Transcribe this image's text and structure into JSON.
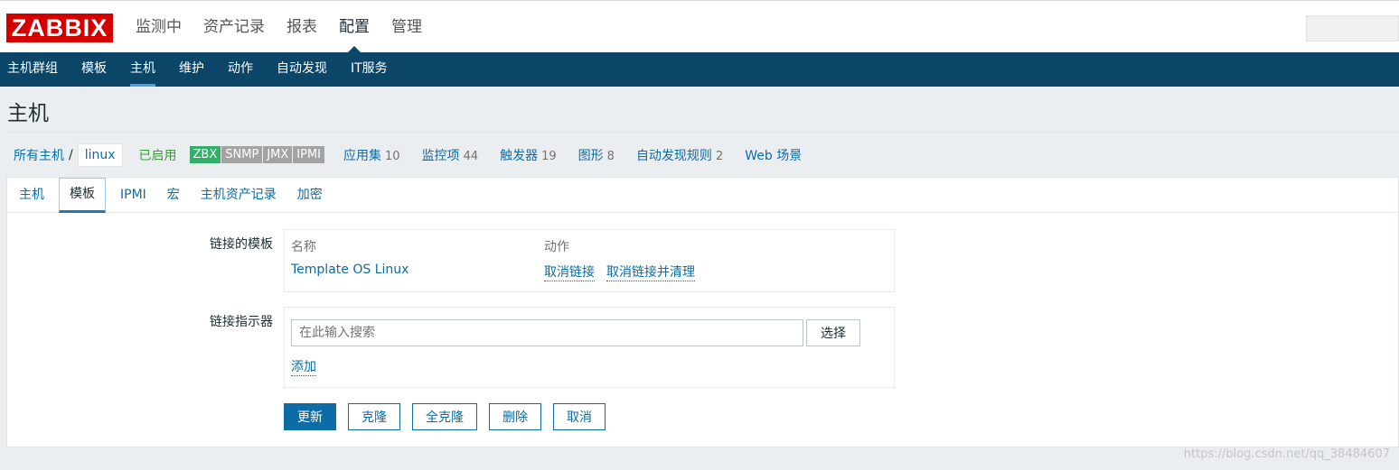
{
  "header": {
    "logo": "ZABBIX",
    "main_nav": [
      "监测中",
      "资产记录",
      "报表",
      "配置",
      "管理"
    ],
    "main_nav_active": 3,
    "sub_nav": [
      "主机群组",
      "模板",
      "主机",
      "维护",
      "动作",
      "自动发现",
      "IT服务"
    ],
    "sub_nav_active": 2
  },
  "page": {
    "title": "主机"
  },
  "breadcrumb": {
    "all_hosts": "所有主机",
    "separator": "/",
    "host": "linux",
    "status": "已启用",
    "badges": [
      {
        "label": "ZBX",
        "on": true
      },
      {
        "label": "SNMP",
        "on": false
      },
      {
        "label": "JMX",
        "on": false
      },
      {
        "label": "IPMI",
        "on": false
      }
    ],
    "links": [
      {
        "label": "应用集",
        "count": "10"
      },
      {
        "label": "监控项",
        "count": "44"
      },
      {
        "label": "触发器",
        "count": "19"
      },
      {
        "label": "图形",
        "count": "8"
      },
      {
        "label": "自动发现规则",
        "count": "2"
      },
      {
        "label": "Web 场景",
        "count": ""
      }
    ]
  },
  "tabs": [
    "主机",
    "模板",
    "IPMI",
    "宏",
    "主机资产记录",
    "加密"
  ],
  "tabs_active": 1,
  "form": {
    "linked_templates_label": "链接的模板",
    "col_name": "名称",
    "col_action": "动作",
    "template_name": "Template OS Linux",
    "unlink": "取消链接",
    "unlink_clear": "取消链接并清理",
    "link_new_label": "链接指示器",
    "search_placeholder": "在此输入搜索",
    "select_button": "选择",
    "add_link": "添加"
  },
  "buttons": {
    "update": "更新",
    "clone": "克隆",
    "full_clone": "全克隆",
    "delete": "删除",
    "cancel": "取消"
  },
  "watermark": "https://blog.csdn.net/qq_38484607",
  "colors": {
    "brand_red": "#d40000",
    "nav_blue": "#0b4669",
    "link_blue": "#0d6ca6",
    "enabled_green": "#3a9a3d",
    "badge_on": "#34af67",
    "badge_off": "#a3a3a3"
  }
}
